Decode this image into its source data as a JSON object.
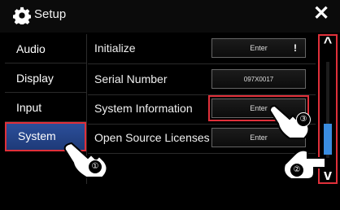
{
  "header": {
    "title": "Setup",
    "close_glyph": "✕"
  },
  "sidebar": {
    "items": [
      {
        "label": "Audio",
        "selected": false
      },
      {
        "label": "Display",
        "selected": false
      },
      {
        "label": "Input",
        "selected": false
      },
      {
        "label": "System",
        "selected": true
      }
    ]
  },
  "rows": [
    {
      "label": "Initialize",
      "button": "Enter",
      "extra": "!"
    },
    {
      "label": "Serial Number",
      "value": "097X0017"
    },
    {
      "label": "System Information",
      "button": "Enter"
    },
    {
      "label": "Open Source Licenses",
      "button": "Enter"
    }
  ],
  "scrollbar": {
    "up_glyph": "^",
    "down_glyph": "v"
  },
  "callouts": {
    "one": "①",
    "two": "②",
    "three": "③"
  },
  "colors": {
    "accent_red": "#e0303a",
    "selected_blue": "#2c4f9a",
    "thumb_blue": "#3a8de0"
  },
  "icons": {
    "gear": "gear-icon",
    "close": "close-icon",
    "hand": "hand-pointer-icon"
  }
}
